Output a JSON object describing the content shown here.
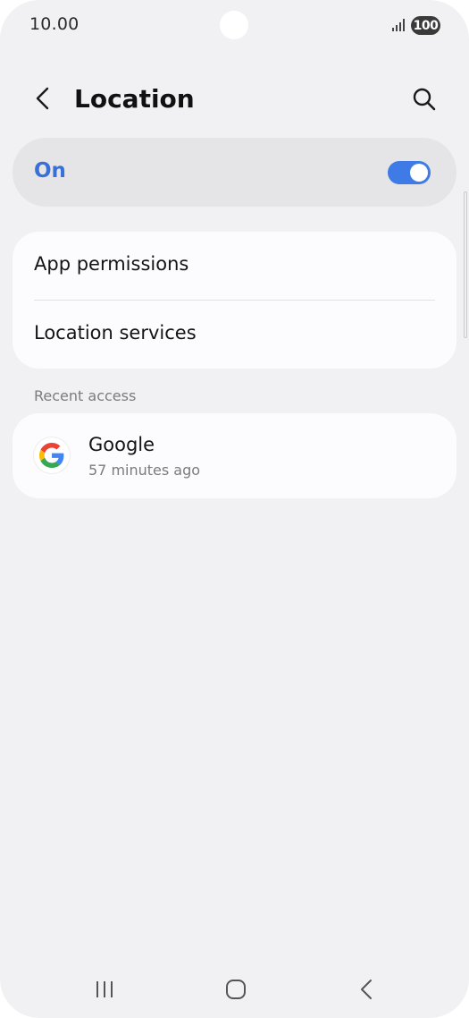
{
  "status_bar": {
    "time": "10.00",
    "battery": "100"
  },
  "header": {
    "title": "Location"
  },
  "master_toggle": {
    "label": "On",
    "enabled": true,
    "accent": "#3e7be6"
  },
  "settings": {
    "items": [
      {
        "label": "App permissions"
      },
      {
        "label": "Location services"
      }
    ]
  },
  "recent_access": {
    "header": "Recent access",
    "apps": [
      {
        "name": "Google",
        "time": "57 minutes ago",
        "icon": "google-icon"
      }
    ]
  },
  "nav_bar": {
    "icons": [
      "recents-icon",
      "home-icon",
      "back-icon"
    ]
  }
}
